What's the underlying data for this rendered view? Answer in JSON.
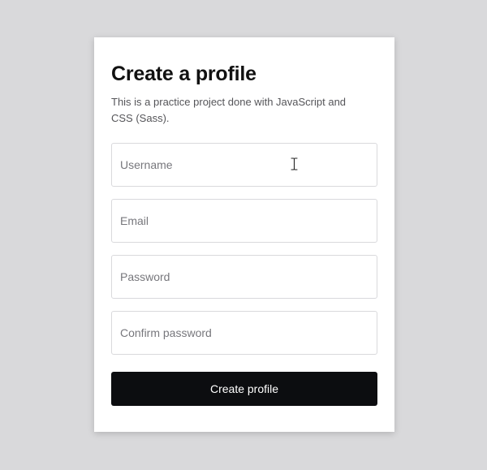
{
  "card": {
    "title": "Create a profile",
    "subtitle": "This is a practice project done with JavaScript and CSS (Sass)."
  },
  "form": {
    "username_placeholder": "Username",
    "email_placeholder": "Email",
    "password_placeholder": "Password",
    "confirm_password_placeholder": "Confirm password",
    "submit_label": "Create profile"
  },
  "colors": {
    "background": "#d9d9db",
    "card": "#ffffff",
    "button": "#0c0d10",
    "button_text": "#ffffff"
  },
  "cursor": {
    "icon": "text-cursor-icon"
  }
}
